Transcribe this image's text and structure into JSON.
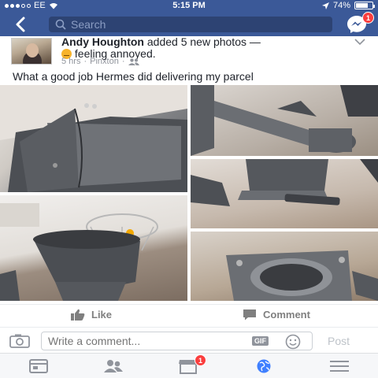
{
  "status_bar": {
    "carrier": "EE",
    "time": "5:15 PM",
    "battery": "74%",
    "battery_level": 0.74
  },
  "nav": {
    "search_placeholder": "Search",
    "messenger_badge": "1"
  },
  "post": {
    "author": "Andy Houghton",
    "action_text": " added 5 new photos — ",
    "feeling_text": "feeling annoyed.",
    "time": "5 hrs",
    "location": "Pinxton",
    "caption": "What a good job Hermes did delivering my parcel"
  },
  "actions": {
    "like": "Like",
    "comment": "Comment"
  },
  "comment_bar": {
    "placeholder": "Write a comment...",
    "gif_label": "GIF",
    "post_label": "Post"
  },
  "tab_bar": {
    "notifications_badge": "1"
  },
  "colors": {
    "facebook_blue": "#3b5998",
    "badge_red": "#fa3e3e"
  }
}
